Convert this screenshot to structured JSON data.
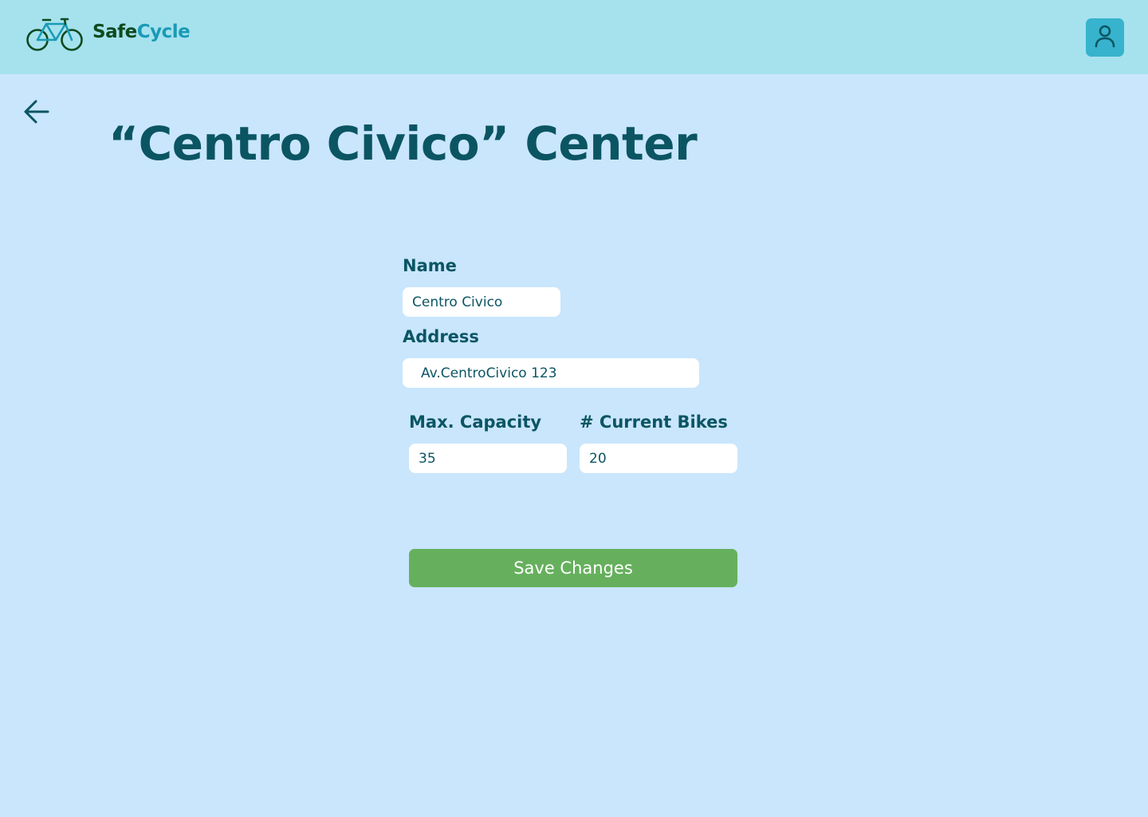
{
  "header": {
    "brand_part1": "Safe",
    "brand_part2": "Cycle",
    "logo_icon": "bicycle-icon",
    "user_icon": "user-icon"
  },
  "back_icon": "arrow-left-icon",
  "page_title": "“Centro Civico” Center",
  "form": {
    "name_label": "Name",
    "name_value": "Centro Civico",
    "address_label": "Address",
    "address_value": "Av.CentroCivico 123",
    "capacity_label": "Max. Capacity",
    "capacity_value": "35",
    "bikes_label": "# Current Bikes",
    "bikes_value": "20",
    "save_label": "Save Changes"
  },
  "colors": {
    "background": "#c9e6fd",
    "header": "#a5e2ee",
    "user_button": "#37b3cd",
    "text": "#0b5563",
    "save_button": "#66b05d"
  }
}
